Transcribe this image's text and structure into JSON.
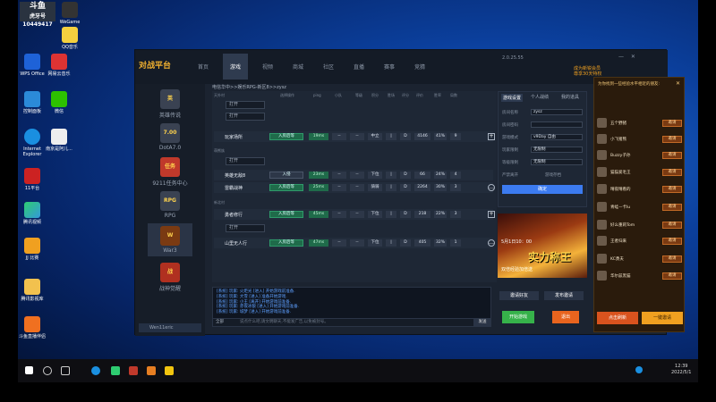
{
  "colors": {
    "accent": "#3c7bf0",
    "go": "#1f6b4a",
    "brand": "#f0b030",
    "friend_bg": "#2a1b0c"
  },
  "stream_logo": {
    "name": "斗鱼",
    "sub": "虎牙号",
    "id": "10449417"
  },
  "desktop_icons": [
    {
      "label": "WPS Office",
      "icon": "wps-icon"
    },
    {
      "label": "网易云音乐",
      "icon": "netease-music-icon"
    },
    {
      "label": "控制面板",
      "icon": "control-panel-icon"
    },
    {
      "label": "微信",
      "icon": "wechat-icon"
    },
    {
      "label": "Internet Explorer",
      "icon": "ie-icon"
    },
    {
      "label": "南京是阿儿...",
      "icon": "document-icon"
    },
    {
      "label": "11平台",
      "icon": "eleven-platform-icon"
    },
    {
      "label": "腾讯视频",
      "icon": "tencent-video-icon"
    },
    {
      "label": "JJ 比赛",
      "icon": "jj-icon"
    },
    {
      "label": "腾讯影视库",
      "icon": "folder-icon"
    },
    {
      "label": "斗鱼直播伴侣",
      "icon": "douyu-icon"
    },
    {
      "label": "QQ音乐",
      "icon": "qq-music-icon"
    },
    {
      "label": "WeGame",
      "icon": "wegame-icon"
    }
  ],
  "window": {
    "brand": "对战平台",
    "nav": [
      "首页",
      "游戏",
      "视频",
      "商城",
      "社区",
      "直播",
      "赛事",
      "竞猜"
    ],
    "active_nav": "游戏",
    "version": "2.0.25.55",
    "ad_line1": "成为新锐会员",
    "ad_line2": "尊享30天特权",
    "breadcrumb": "电信华中>>娱乐RPG-新区8>>zysz",
    "games": [
      "英雄传说",
      "DotA7.0",
      "9211任务中心",
      "RPG",
      "War3",
      "战神觉醒"
    ],
    "active_game": "War3",
    "user_chip": "Wen11eric"
  },
  "list": {
    "headers": [
      "选择操作",
      "ping",
      "小队",
      "等级",
      "积分",
      "胜场",
      "评分",
      "评价",
      "胜率",
      "局数"
    ],
    "sections": [
      {
        "title": "天外村",
        "filter": "打开",
        "filter2": "打开",
        "rows": [
          {
            "name": "玩家场所",
            "btn": "入房后等",
            "latency": "19ms",
            "c1": "--",
            "c2": "--",
            "c3": "中立",
            "c4": "|",
            "c5": "D",
            "c6": "4146",
            "c7": "41%",
            "c8": "9"
          }
        ]
      },
      {
        "title": "萌熊族",
        "filter": "打开",
        "rows": [
          {
            "name": "英雄无敌8",
            "btn": "入侵",
            "latency": "23ms",
            "c1": "--",
            "c2": "--",
            "c3": "下位",
            "c4": "|",
            "c5": "D",
            "c6": "66",
            "c7": "24%",
            "c8": "4"
          },
          {
            "name": "雷霸战神",
            "btn": "入房后等",
            "latency": "25ms",
            "c1": "--",
            "c2": "--",
            "c3": "骑骑",
            "c4": "|",
            "c5": "D",
            "c6": "2264",
            "c7": "30%",
            "c8": "3"
          }
        ]
      },
      {
        "title": "新北村",
        "filter": "打开",
        "rows": [
          {
            "name": "勇者修行",
            "btn": "入房后等",
            "latency": "45ms",
            "c1": "--",
            "c2": "--",
            "c3": "下位",
            "c4": "|",
            "c5": "D",
            "c6": "218",
            "c7": "22%",
            "c8": "3"
          },
          {
            "name": "山里无人行",
            "btn": "入房后等",
            "latency": "47ms",
            "c1": "--",
            "c2": "--",
            "c3": "下位",
            "c4": "|",
            "c5": "D",
            "c6": "405",
            "c7": "32%",
            "c8": "1"
          }
        ]
      }
    ]
  },
  "chat": {
    "lines": [
      "[系统] 玩家: 火炬光 [进入] 开始游戏前准备.",
      "[系统] 玩家: 大雪 [进入] 准备开始游戏.",
      "[系统] 玩家: 小王 [离开] 开始游戏前准备.",
      "[系统] 玩家: 赤夜冰狼 [进入] 开始游戏前准备.",
      "[系统] 玩家: 城梦 [进入] 开始游戏前准备."
    ],
    "mode": "全部",
    "placeholder": "说点什么吧,请文明聊天,不能发广告,以免被封号。",
    "send": "发送"
  },
  "settings": {
    "tabs": [
      "游戏设置",
      "个人战绩",
      "我的道具"
    ],
    "fields": [
      {
        "label": "房间名称",
        "value": "zysz"
      },
      {
        "label": "房间密码",
        "value": ""
      },
      {
        "label": "游戏模式",
        "value": "v9Day 自由"
      },
      {
        "label": "玩家限制",
        "value": "无限制"
      },
      {
        "label": "等级限制",
        "value": "无限制"
      }
    ],
    "check1": "严禁离开",
    "check2": "游戏存档",
    "confirm": "确定"
  },
  "banner": {
    "date": "5月1日10：00",
    "title": "实力称王",
    "subtitle": "双倍经验加倍送"
  },
  "actions": {
    "invite": "邀请好友",
    "voice": "发布邀请",
    "start": "开始游戏",
    "exit": "退出"
  },
  "friends": {
    "title": "为你找到一些经验水平相近的朋友:",
    "invite": "邀请",
    "list": [
      "五个野猪",
      "小飞猪熊",
      "Buzzy子孙",
      "猫猫爱毛王",
      "晴夜晴看的",
      "青蛙—卡lu",
      "好么重莉Tom",
      "王者归来",
      "KC勇夫",
      "华尔兹黑猫"
    ],
    "refresh": "点击刷新",
    "invite_all": "一键邀请"
  },
  "taskbar": {
    "time": "12:39",
    "date": "2022/5/1"
  }
}
